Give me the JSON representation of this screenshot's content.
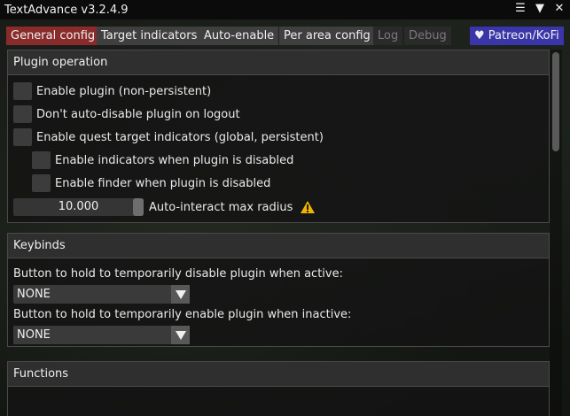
{
  "window": {
    "title": "TextAdvance v3.2.4.9"
  },
  "title_controls": {
    "menu_glyph": "☰",
    "collapse_glyph": "▼",
    "close_glyph": "✕"
  },
  "tabs": [
    {
      "label": "General config",
      "state": "active"
    },
    {
      "label": "Target indicators",
      "state": "normal"
    },
    {
      "label": "Auto-enable",
      "state": "normal"
    },
    {
      "label": "Per area config",
      "state": "normal"
    },
    {
      "label": "Log",
      "state": "disabled"
    },
    {
      "label": "Debug",
      "state": "disabled"
    },
    {
      "label": "♥ Patreon/KoFi",
      "state": "patreon"
    }
  ],
  "plugin_operation": {
    "header": "Plugin operation",
    "options": [
      {
        "label": "Enable plugin (non-persistent)",
        "checked": false
      },
      {
        "label": "Don't auto-disable plugin on logout",
        "checked": false
      },
      {
        "label": "Enable quest target indicators (global, persistent)",
        "checked": false
      },
      {
        "label": "Enable indicators when plugin is disabled",
        "checked": false
      },
      {
        "label": "Enable finder when plugin is disabled",
        "checked": false
      }
    ],
    "slider": {
      "value": "10.000",
      "label": "Auto-interact max radius",
      "warning_icon": "warning-icon"
    }
  },
  "keybinds": {
    "header": "Keybinds",
    "disable_label": "Button to hold to temporarily disable plugin when active:",
    "disable_value": "NONE",
    "enable_label": "Button to hold to temporarily enable plugin when inactive:",
    "enable_value": "NONE"
  },
  "functions": {
    "header": "Functions"
  },
  "colors": {
    "accent_active_tab": "#8a2b2b",
    "patreon_tab": "#3a35a8",
    "warning": "#f0b400"
  }
}
